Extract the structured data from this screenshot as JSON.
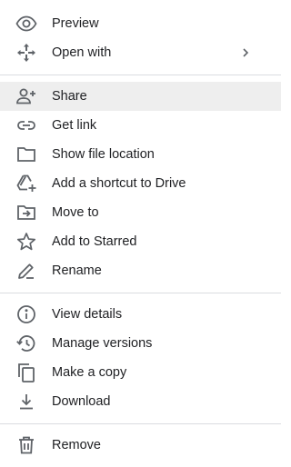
{
  "menu": {
    "items": [
      {
        "label": "Preview",
        "icon": "eye-icon"
      },
      {
        "label": "Open with",
        "icon": "move-arrows-icon",
        "submenu": true
      },
      {
        "label": "Share",
        "icon": "add-person-icon",
        "highlighted": true
      },
      {
        "label": "Get link",
        "icon": "link-icon"
      },
      {
        "label": "Show file location",
        "icon": "folder-icon"
      },
      {
        "label": "Add a shortcut to Drive",
        "icon": "drive-add-shortcut-icon"
      },
      {
        "label": "Move to",
        "icon": "move-to-folder-icon"
      },
      {
        "label": "Add to Starred",
        "icon": "star-icon"
      },
      {
        "label": "Rename",
        "icon": "pencil-icon"
      },
      {
        "label": "View details",
        "icon": "info-icon"
      },
      {
        "label": "Manage versions",
        "icon": "history-icon"
      },
      {
        "label": "Make a copy",
        "icon": "copy-icon"
      },
      {
        "label": "Download",
        "icon": "download-icon"
      },
      {
        "label": "Remove",
        "icon": "trash-icon"
      }
    ]
  },
  "colors": {
    "icon": "#5f6368",
    "text": "#202124",
    "highlight": "#eeeeee",
    "divider": "#dadce0"
  }
}
